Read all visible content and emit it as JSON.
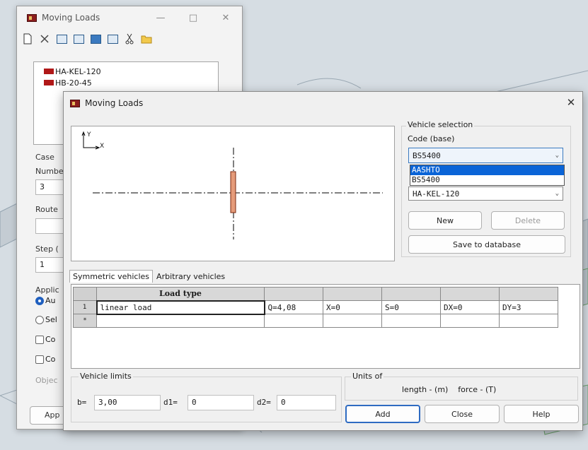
{
  "back_window": {
    "title": "Moving Loads",
    "controls": [
      "—",
      "□",
      "✕"
    ],
    "list_items": [
      "HA-KEL-120",
      "HB-20-45"
    ],
    "case_label": "Case",
    "number_label": "Numbe",
    "number_value": "3",
    "route_label": "Route",
    "step_label": "Step (",
    "step_value": "1",
    "apply_label": "Applic",
    "radio_auto": "Au",
    "radio_sel": "Sel",
    "check1": "Co",
    "check2": "Co",
    "objects_label": "Objec",
    "apply_button": "App"
  },
  "dialog": {
    "title": "Moving Loads",
    "close": "✕",
    "axis_y": "Y",
    "axis_x": "X"
  },
  "vehicle_selection": {
    "legend": "Vehicle selection",
    "code_label": "Code (base)",
    "code_value": "BS5400",
    "dropdown_options": [
      "AASHTO",
      "BS5400"
    ],
    "dropdown_highlight": "AASHTO",
    "vehicle_value": "HA-KEL-120",
    "new_label": "New",
    "delete_label": "Delete",
    "save_label": "Save to database"
  },
  "tabs": [
    "Symmetric vehicles",
    "Arbitrary vehicles"
  ],
  "grid": {
    "headers": [
      "",
      "Load type",
      "",
      "",
      "",
      "",
      ""
    ],
    "rows": [
      [
        "1",
        "linear load",
        "Q=4,08",
        "X=0",
        "S=0",
        "DX=0",
        "DY=3"
      ],
      [
        "*",
        "",
        "",
        "",
        "",
        "",
        ""
      ]
    ]
  },
  "limits": {
    "legend": "Vehicle limits",
    "b_label": "b=",
    "b_value": "3,00",
    "d1_label": "d1=",
    "d1_value": "0",
    "d2_label": "d2=",
    "d2_value": "0"
  },
  "units": {
    "legend": "Units of",
    "text": "length - (m)    force - (T)"
  },
  "buttons": {
    "add": "Add",
    "close": "Close",
    "help": "Help"
  }
}
